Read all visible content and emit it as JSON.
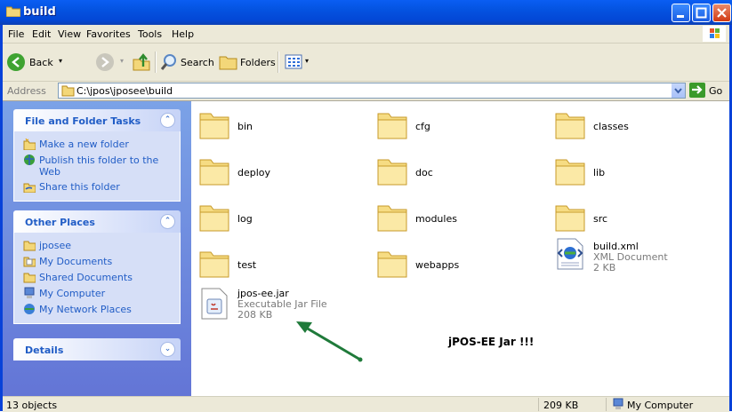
{
  "window": {
    "title": "build"
  },
  "menu": [
    "File",
    "Edit",
    "View",
    "Favorites",
    "Tools",
    "Help"
  ],
  "toolbar": {
    "back": "Back",
    "search": "Search",
    "folders": "Folders"
  },
  "address": {
    "label": "Address",
    "path": "C:\\jpos\\jposee\\build",
    "go": "Go"
  },
  "tasks": {
    "title": "File and Folder Tasks",
    "items": [
      "Make a new folder",
      "Publish this folder to the Web",
      "Share this folder"
    ]
  },
  "places": {
    "title": "Other Places",
    "items": [
      "jposee",
      "My Documents",
      "Shared Documents",
      "My Computer",
      "My Network Places"
    ]
  },
  "details": {
    "title": "Details"
  },
  "files": [
    {
      "name": "bin",
      "kind": "folder"
    },
    {
      "name": "cfg",
      "kind": "folder"
    },
    {
      "name": "classes",
      "kind": "folder"
    },
    {
      "name": "deploy",
      "kind": "folder"
    },
    {
      "name": "doc",
      "kind": "folder"
    },
    {
      "name": "lib",
      "kind": "folder"
    },
    {
      "name": "log",
      "kind": "folder"
    },
    {
      "name": "modules",
      "kind": "folder"
    },
    {
      "name": "src",
      "kind": "folder"
    },
    {
      "name": "test",
      "kind": "folder"
    },
    {
      "name": "webapps",
      "kind": "folder"
    },
    {
      "name": "build.xml",
      "type": "XML Document",
      "size": "2 KB",
      "kind": "xml"
    },
    {
      "name": "jpos-ee.jar",
      "type": "Executable Jar File",
      "size": "208 KB",
      "kind": "jar"
    }
  ],
  "annotation": "jPOS-EE Jar !!!",
  "status": {
    "objects": "13 objects",
    "size": "209 KB",
    "location": "My Computer"
  },
  "colors": {
    "titlebar": "#0453e0",
    "taskpane": "#7ba2e7",
    "link": "#215dc6",
    "arrow": "#1f7a3a"
  }
}
